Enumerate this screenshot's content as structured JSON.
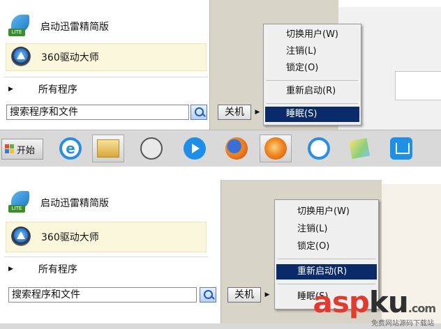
{
  "programs": [
    {
      "label": "启动迅雷精简版",
      "icon": "thunder-lite-icon"
    },
    {
      "label": "360驱动大师",
      "icon": "driver-master-icon"
    }
  ],
  "all_programs": "所有程序",
  "search_placeholder": "搜索程序和文件",
  "shutdown_label": "关机",
  "top_menu": {
    "items": [
      "切换用户(W)",
      "注销(L)",
      "锁定(O)",
      "重新启动(R)",
      "睡眠(S)"
    ],
    "selected": "睡眠(S)"
  },
  "bottom_menu": {
    "items": [
      "切换用户(W)",
      "注销(L)",
      "锁定(O)",
      "重新启动(R)",
      "睡眠(S)"
    ],
    "selected": "重新启动(R)"
  },
  "taskbar": {
    "start_label": "开始",
    "icons": [
      "ie-icon",
      "explorer-folder-icon",
      "media-reel-icon",
      "media-player-icon",
      "firefox-icon",
      "thunder-icon",
      "cloud-drive-icon",
      "sticky-notes-icon",
      "download-manager-icon"
    ]
  },
  "watermark": {
    "text_a": "asp",
    "text_k": "ku",
    "suffix": ".com",
    "sub": "免费网站源码下载站"
  },
  "colors": {
    "selection": "#0a2a6a",
    "menu_bg": "#f0f0f0",
    "highlight_item": "#fbf7dc",
    "logo_red": "#e23a2d"
  }
}
